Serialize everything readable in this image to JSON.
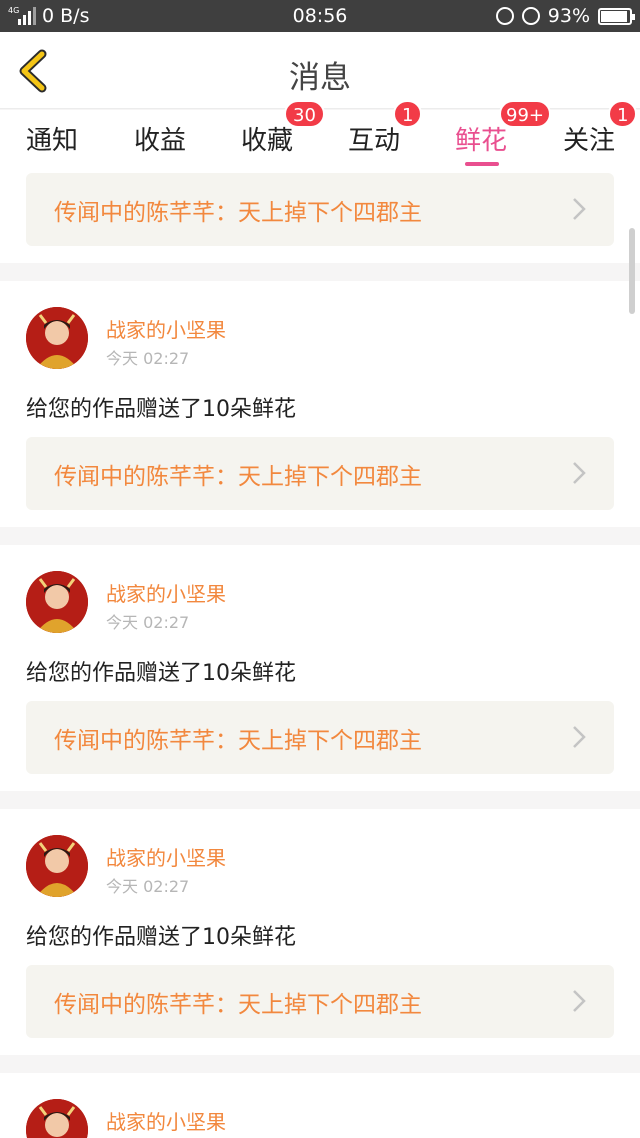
{
  "status_bar": {
    "network_type": "4G",
    "speed": "0 B/s",
    "time": "08:56",
    "battery": "93%"
  },
  "header": {
    "title": "消息",
    "back_icon": "chevron-left-icon"
  },
  "tabs": [
    {
      "label": "通知",
      "badge": ""
    },
    {
      "label": "收益",
      "badge": ""
    },
    {
      "label": "收藏",
      "badge": "30"
    },
    {
      "label": "互动",
      "badge": "1"
    },
    {
      "label": "鲜花",
      "badge": "99+",
      "active": true
    },
    {
      "label": "关注",
      "badge": "1"
    }
  ],
  "colors": {
    "accent_pink": "#e94f8f",
    "orange_text": "#f2883e",
    "badge_red": "#f23b47",
    "back_arrow": "#f4c516"
  },
  "first_work_card": {
    "title": "传闻中的陈芊芊：天上掉下个四郡主"
  },
  "messages": [
    {
      "sender": "战家的小坚果",
      "time": "今天 02:27",
      "text": "给您的作品赠送了10朵鲜花",
      "work_title": "传闻中的陈芊芊：天上掉下个四郡主"
    },
    {
      "sender": "战家的小坚果",
      "time": "今天 02:27",
      "text": "给您的作品赠送了10朵鲜花",
      "work_title": "传闻中的陈芊芊：天上掉下个四郡主"
    },
    {
      "sender": "战家的小坚果",
      "time": "今天 02:27",
      "text": "给您的作品赠送了10朵鲜花",
      "work_title": "传闻中的陈芊芊：天上掉下个四郡主"
    },
    {
      "sender": "战家的小坚果"
    }
  ]
}
